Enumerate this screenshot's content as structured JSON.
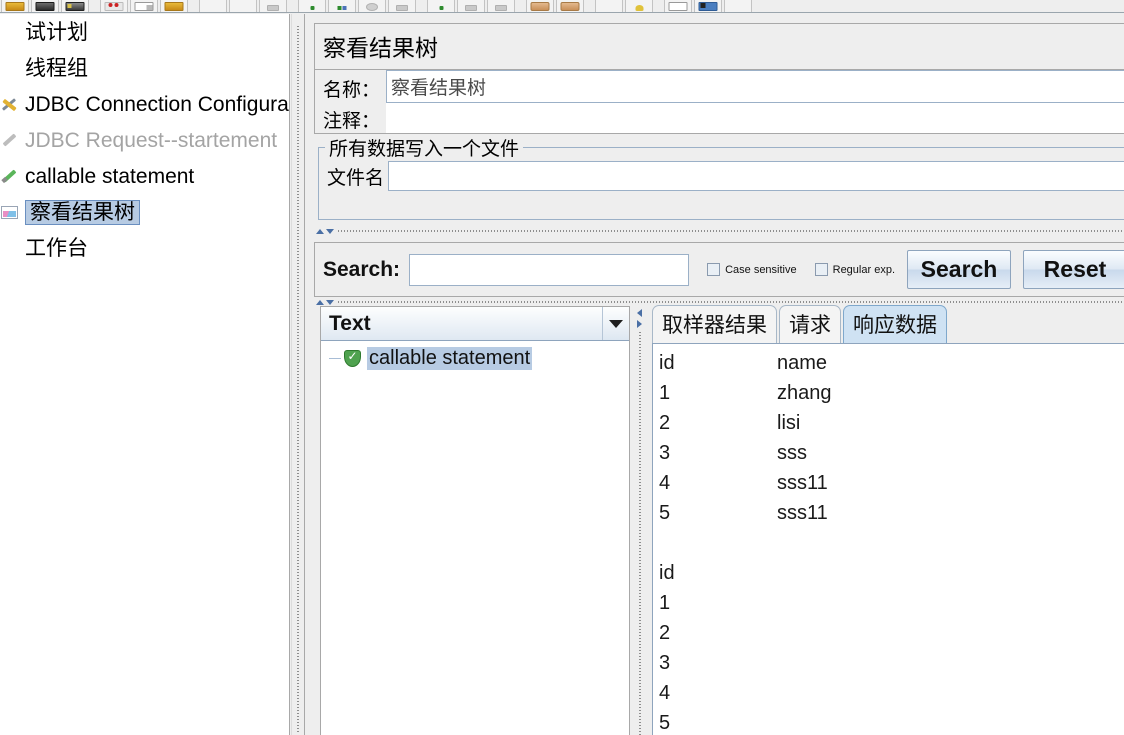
{
  "toolbar": {
    "groups": [
      {
        "buttons": [
          {
            "name": "new-button",
            "icon": "folder-icon"
          },
          {
            "name": "templates-button",
            "icon": "disk-icon"
          },
          {
            "name": "open-button",
            "icon": "disk2-icon"
          }
        ]
      },
      {
        "buttons": [
          {
            "name": "close-button",
            "icon": "cut-icon"
          },
          {
            "name": "save-button",
            "icon": "paper-icon"
          },
          {
            "name": "save-as-button",
            "icon": "folder-icon"
          }
        ]
      },
      {
        "buttons": [
          {
            "name": "cut-button",
            "icon": "blank-icon"
          },
          {
            "name": "copy-button",
            "icon": "blank-icon"
          },
          {
            "name": "paste-button",
            "icon": "grey2-icon"
          }
        ]
      },
      {
        "buttons": [
          {
            "name": "start-button",
            "icon": "green-icon"
          },
          {
            "name": "start-no-pauses-button",
            "icon": "greenblue-icon"
          },
          {
            "name": "stop-button",
            "icon": "grey-icon"
          },
          {
            "name": "shutdown-button",
            "icon": "grey2-icon"
          }
        ]
      },
      {
        "buttons": [
          {
            "name": "remote-start-button",
            "icon": "green-icon"
          },
          {
            "name": "remote-stop-button",
            "icon": "grey2-icon"
          },
          {
            "name": "remote-shutdown-button",
            "icon": "grey2-icon"
          }
        ]
      },
      {
        "buttons": [
          {
            "name": "clear-button",
            "icon": "hand-icon"
          },
          {
            "name": "clear-all-button",
            "icon": "hand-icon"
          }
        ]
      },
      {
        "buttons": [
          {
            "name": "search-button",
            "icon": "blank-icon"
          },
          {
            "name": "reset-search-button",
            "icon": "bulb-icon"
          }
        ]
      },
      {
        "buttons": [
          {
            "name": "function-helper-button",
            "icon": "win-icon"
          },
          {
            "name": "help-button",
            "icon": "winblue-icon"
          },
          {
            "name": "extra-button",
            "icon": "blank-icon"
          }
        ]
      }
    ]
  },
  "sidebar": {
    "items": [
      {
        "label": "试计划",
        "icon": "none",
        "cjk": true,
        "dim": false,
        "selected": false
      },
      {
        "label": "线程组",
        "icon": "none",
        "cjk": true,
        "dim": false,
        "selected": false
      },
      {
        "label": "JDBC Connection Configurat",
        "icon": "wrench-icon",
        "cjk": false,
        "dim": false,
        "selected": false
      },
      {
        "label": "JDBC Request--startement",
        "icon": "pen-icon",
        "cjk": false,
        "dim": true,
        "selected": false
      },
      {
        "label": "callable statement",
        "icon": "pen-green-icon",
        "cjk": false,
        "dim": false,
        "selected": false
      },
      {
        "label": "察看结果树",
        "icon": "chart-icon",
        "cjk": true,
        "dim": false,
        "selected": true
      },
      {
        "label": "工作台",
        "icon": "none",
        "cjk": true,
        "dim": false,
        "selected": false
      }
    ]
  },
  "panel": {
    "title": "察看结果树",
    "name_label": "名称：",
    "name_value": "察看结果树",
    "comment_label": "注释：",
    "comment_value": "",
    "groupbox_legend": "所有数据写入一个文件",
    "filename_label": "文件名",
    "filename_value": ""
  },
  "search": {
    "label": "Search:",
    "value": "",
    "case_sensitive_label": "Case sensitive",
    "case_sensitive_checked": false,
    "regular_exp_label": "Regular exp.",
    "regular_exp_checked": false,
    "search_button": "Search",
    "reset_button": "Reset"
  },
  "result_tree": {
    "render_selector": "Text",
    "nodes": [
      {
        "label": "callable statement",
        "status": "success",
        "selected": true
      }
    ]
  },
  "tabs": [
    {
      "label": "取样器结果",
      "active": false
    },
    {
      "label": "请求",
      "active": false
    },
    {
      "label": "响应数据",
      "active": true
    }
  ],
  "response_data": {
    "blocks": [
      {
        "rows": [
          {
            "id": "id",
            "name": "name"
          },
          {
            "id": "1",
            "name": "zhang"
          },
          {
            "id": "2",
            "name": "lisi"
          },
          {
            "id": "3",
            "name": "sss"
          },
          {
            "id": "4",
            "name": "sss11"
          },
          {
            "id": "5",
            "name": "sss11"
          }
        ]
      },
      {
        "rows": [
          {
            "id": "id",
            "name": ""
          },
          {
            "id": "1",
            "name": ""
          },
          {
            "id": "2",
            "name": ""
          },
          {
            "id": "3",
            "name": ""
          },
          {
            "id": "4",
            "name": ""
          },
          {
            "id": "5",
            "name": ""
          }
        ]
      }
    ]
  },
  "colors": {
    "selection_bg": "#b7cbe3",
    "selection_border": "#6a8fc0",
    "active_tab_bg": "#cfe2f3",
    "panel_bg": "#eeeeee",
    "field_border": "#9bb0c7"
  }
}
